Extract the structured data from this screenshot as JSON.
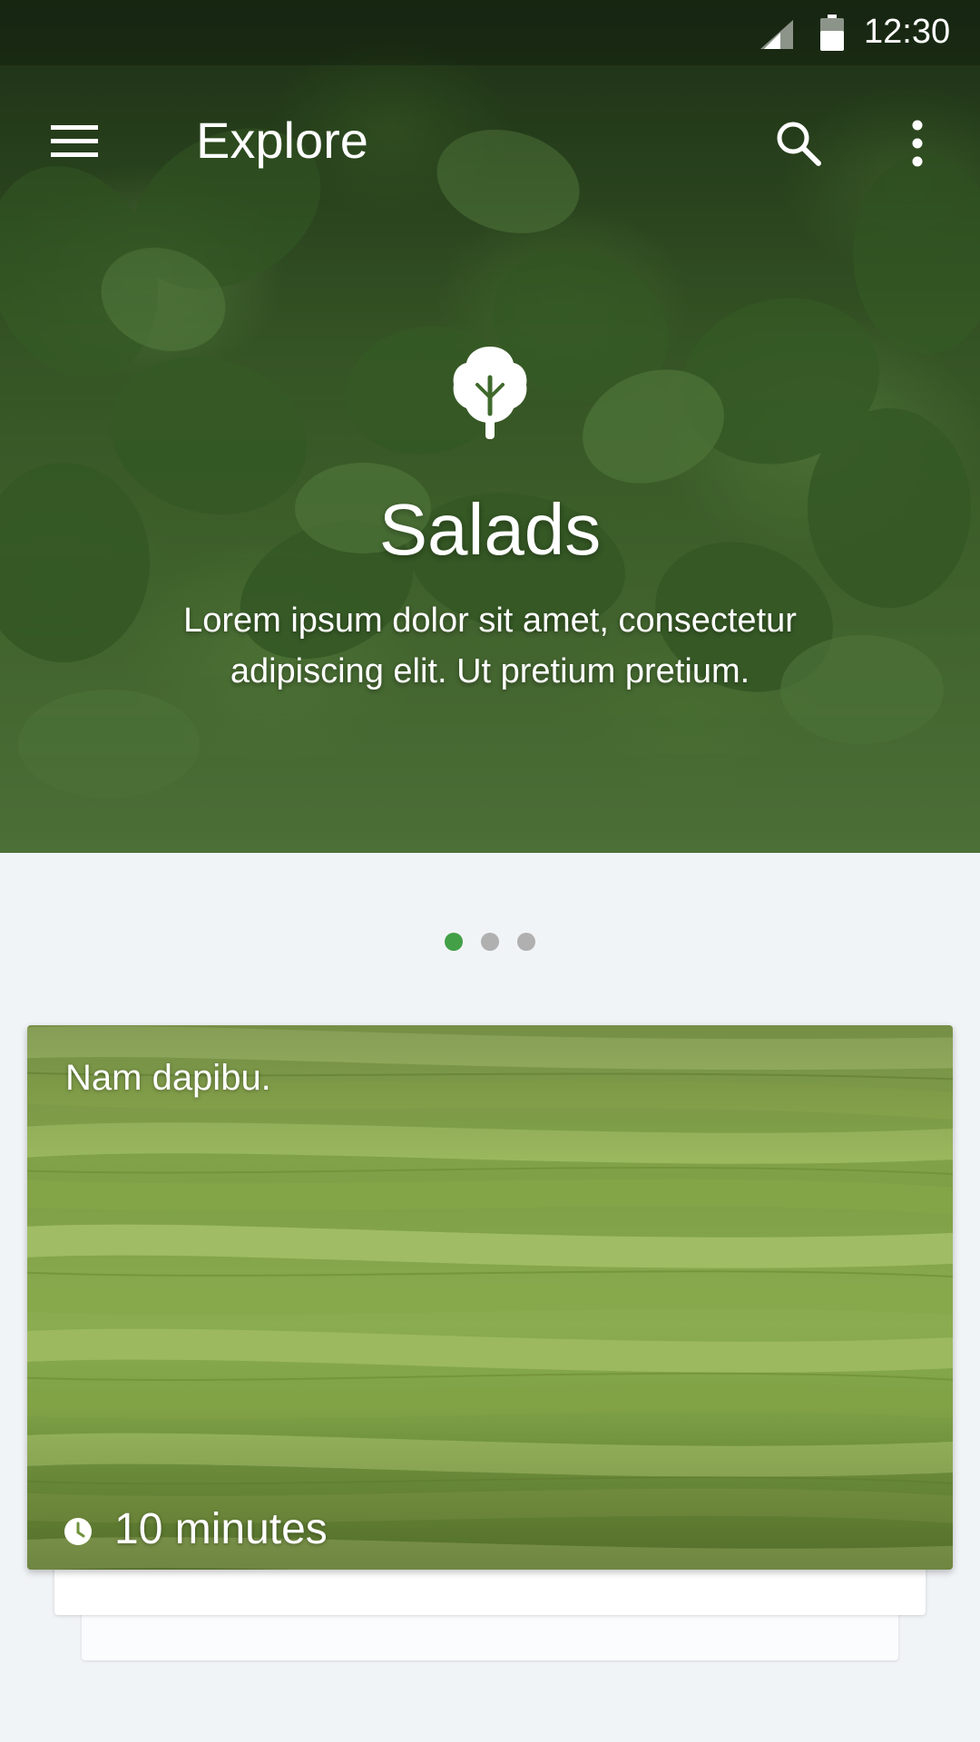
{
  "status_bar": {
    "time": "12:30",
    "icons": [
      "cell-signal-icon",
      "battery-icon"
    ]
  },
  "app_bar": {
    "title": "Explore",
    "icons": [
      "menu-icon",
      "search-icon",
      "more-vert-icon"
    ]
  },
  "hero": {
    "icon": "salad-leaf-icon",
    "title": "Salads",
    "description": "Lorem ipsum dolor sit amet, consectetur adipiscing elit. Ut pretium pretium."
  },
  "pager": {
    "count": 3,
    "active_index": 0
  },
  "card": {
    "title": "Nam dapibu.",
    "time_icon": "clock-icon",
    "time": "10 minutes"
  },
  "colors": {
    "accent": "#43a047",
    "pager_inactive": "#b0b0b0",
    "background": "#f1f4f7",
    "text_on_image": "#ffffff"
  }
}
